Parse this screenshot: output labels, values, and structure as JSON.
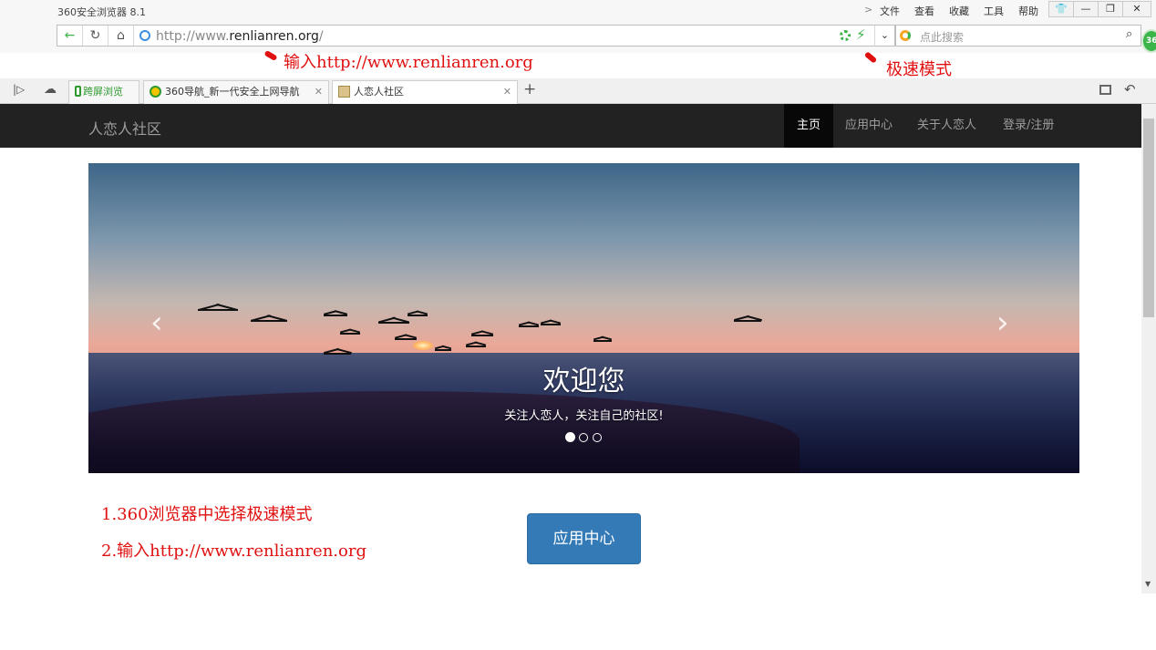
{
  "app": {
    "title": "360安全浏览器 8.1",
    "menu": [
      "文件",
      "查看",
      "收藏",
      "工具",
      "帮助"
    ],
    "menu_arrow": ">",
    "window_buttons": {
      "skin": "👕",
      "minimize": "—",
      "maximize": "❐",
      "close": "✕"
    },
    "badge": "360"
  },
  "address_bar": {
    "url_prefix": "http://www.",
    "url_domain": "renlianren.org",
    "url_suffix": "/",
    "search_placeholder": "点此搜索"
  },
  "annotations": {
    "url_hint": "输入http://www.renlianren.org",
    "mode_hint": "极速模式",
    "step1": "1.360浏览器中选择极速模式",
    "step2": "2.输入http://www.renlianren.org"
  },
  "tabs": {
    "cross_screen": "跨屏浏览",
    "items": [
      {
        "label": "360导航_新一代安全上网导航"
      },
      {
        "label": "人恋人社区"
      }
    ],
    "new_tab": "+"
  },
  "site": {
    "brand": "人恋人社区",
    "nav": [
      "主页",
      "应用中心",
      "关于人恋人",
      "登录/注册"
    ],
    "carousel": {
      "title": "欢迎您",
      "subtitle": "关注人恋人，关注自己的社区!",
      "active_slide": 1,
      "slide_count": 3
    },
    "apps_button": "应用中心"
  },
  "colors": {
    "nav_bg": "#222222",
    "primary_button": "#337ab7",
    "annotation_red": "#e01010"
  }
}
